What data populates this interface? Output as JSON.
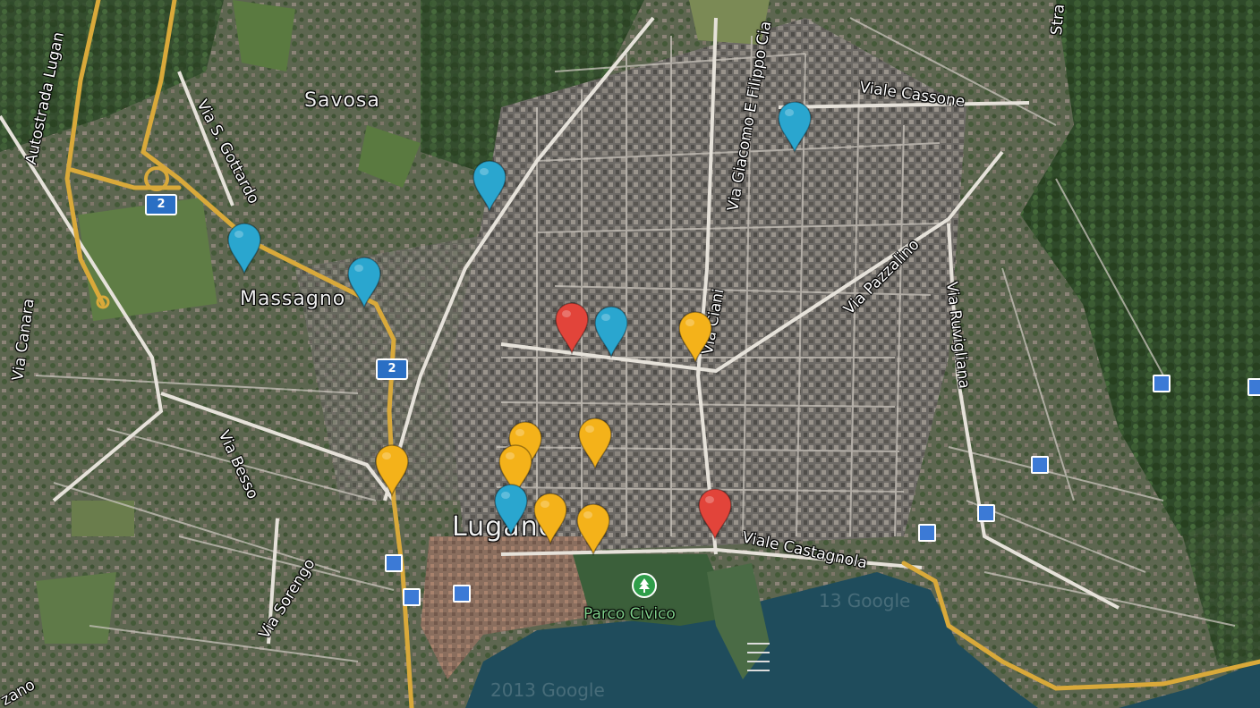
{
  "map": {
    "colors": {
      "marker_blue": "#2aa6cf",
      "marker_yellow": "#f4b21a",
      "marker_red": "#e2443a",
      "highway": "#d9a93a",
      "lake": "#1f4c5c"
    },
    "place_labels": {
      "savosa": "Savosa",
      "massagno": "Massagno",
      "lugano": "Lugano",
      "parco_civico": "Parco Civico"
    },
    "street_labels": {
      "autostrada": "Autostrada Lugan",
      "via_s_gottardo": "Via S. Gottardo",
      "via_giacomo": "Via Giacomo E Filippo Cia",
      "viale_cassone": "Viale Cassone",
      "via_pazzalino": "Via Pazzalino",
      "via_ruvigliana": "Via Ruvigliana",
      "via_canara": "Via Canara",
      "via_besso": "Via Besso",
      "via_sorengo": "Via Sorengo",
      "viale_castagnola": "Viale Castagnola",
      "via_ciani": "Via Ciani",
      "stra": "Stra",
      "zano": "zano"
    },
    "highway_shields": [
      "2",
      "2"
    ],
    "watermarks": [
      "2013 Google",
      "13 Google"
    ],
    "icons": {
      "marker": "map-pin-icon",
      "bus_stop": "bus-stop-icon",
      "park": "tree-icon"
    },
    "markers": [
      {
        "id": "m1",
        "color": "blue"
      },
      {
        "id": "m2",
        "color": "blue"
      },
      {
        "id": "m3",
        "color": "blue"
      },
      {
        "id": "m4",
        "color": "blue"
      },
      {
        "id": "m5",
        "color": "red"
      },
      {
        "id": "m6",
        "color": "blue"
      },
      {
        "id": "m7",
        "color": "yellow"
      },
      {
        "id": "m8",
        "color": "yellow"
      },
      {
        "id": "m9",
        "color": "yellow"
      },
      {
        "id": "m10",
        "color": "yellow"
      },
      {
        "id": "m11",
        "color": "yellow"
      },
      {
        "id": "m12",
        "color": "blue"
      },
      {
        "id": "m13",
        "color": "yellow"
      },
      {
        "id": "m14",
        "color": "yellow"
      },
      {
        "id": "m15",
        "color": "red"
      },
      {
        "id": "m16",
        "color": "blue"
      }
    ]
  }
}
